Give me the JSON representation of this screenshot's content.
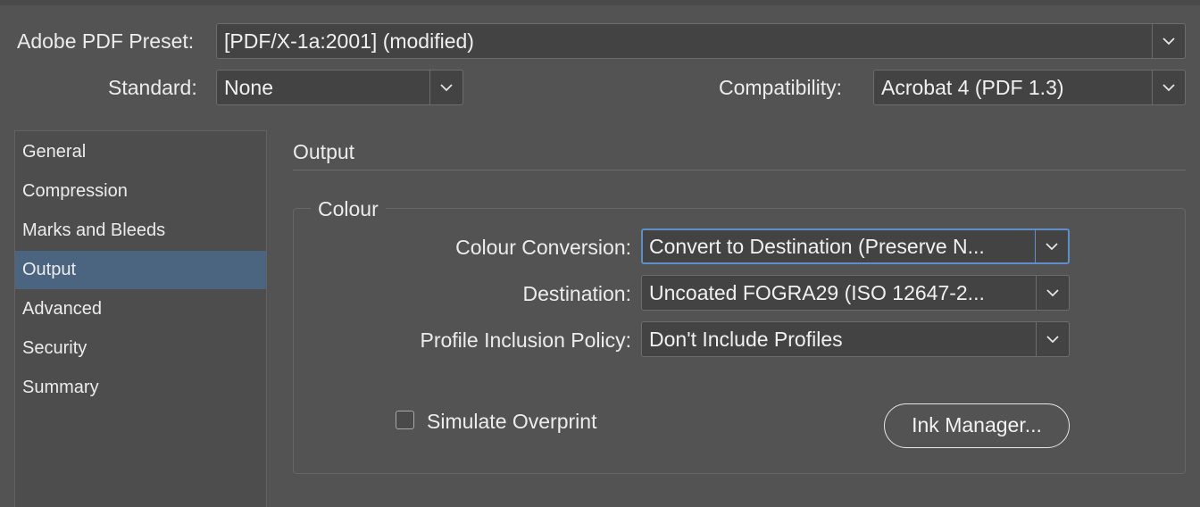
{
  "header": {
    "preset_label": "Adobe PDF Preset:",
    "preset_value": "[PDF/X-1a:2001] (modified)",
    "standard_label": "Standard:",
    "standard_value": "None",
    "compat_label": "Compatibility:",
    "compat_value": "Acrobat 4 (PDF 1.3)"
  },
  "sidebar": {
    "items": [
      {
        "label": "General",
        "selected": false
      },
      {
        "label": "Compression",
        "selected": false
      },
      {
        "label": "Marks and Bleeds",
        "selected": false
      },
      {
        "label": "Output",
        "selected": true
      },
      {
        "label": "Advanced",
        "selected": false
      },
      {
        "label": "Security",
        "selected": false
      },
      {
        "label": "Summary",
        "selected": false
      }
    ]
  },
  "main": {
    "heading": "Output",
    "colour_group": {
      "title": "Colour",
      "conversion_label": "Colour Conversion:",
      "conversion_value": "Convert to Destination (Preserve N...",
      "destination_label": "Destination:",
      "destination_value": "Uncoated FOGRA29 (ISO 12647-2...",
      "profile_label": "Profile Inclusion Policy:",
      "profile_value": "Don't Include Profiles"
    },
    "simulate_overprint_label": "Simulate Overprint",
    "simulate_overprint_checked": false,
    "ink_manager_label": "Ink Manager..."
  },
  "icons": {
    "dropdown": "chevron-down-icon",
    "checkbox": "checkbox-unchecked-icon"
  },
  "colors": {
    "background": "#535353",
    "selection": "#4b6480",
    "focus_ring": "#5f8fc8",
    "text": "#ececec"
  }
}
